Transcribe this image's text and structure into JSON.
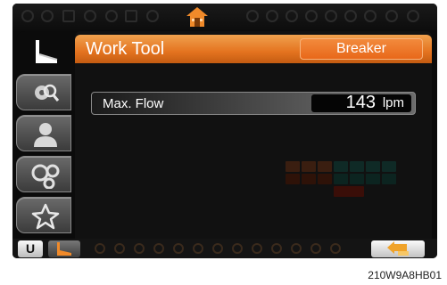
{
  "header": {
    "title": "Work Tool",
    "value": "Breaker"
  },
  "flow": {
    "label": "Max. Flow",
    "value": "143",
    "unit": "lpm"
  },
  "sidebar": {
    "items": [
      {
        "icon": "breaker-tool-icon",
        "active": true
      },
      {
        "icon": "gear-magnifier-icon",
        "active": false
      },
      {
        "icon": "user-icon",
        "active": false
      },
      {
        "icon": "gauges-icon",
        "active": false
      },
      {
        "icon": "star-icon",
        "active": false
      }
    ]
  },
  "bottom": {
    "u_label": "U"
  },
  "caption": "210W9A8HB01",
  "colors": {
    "accent": "#e8731f",
    "background": "#0b0b0b"
  }
}
